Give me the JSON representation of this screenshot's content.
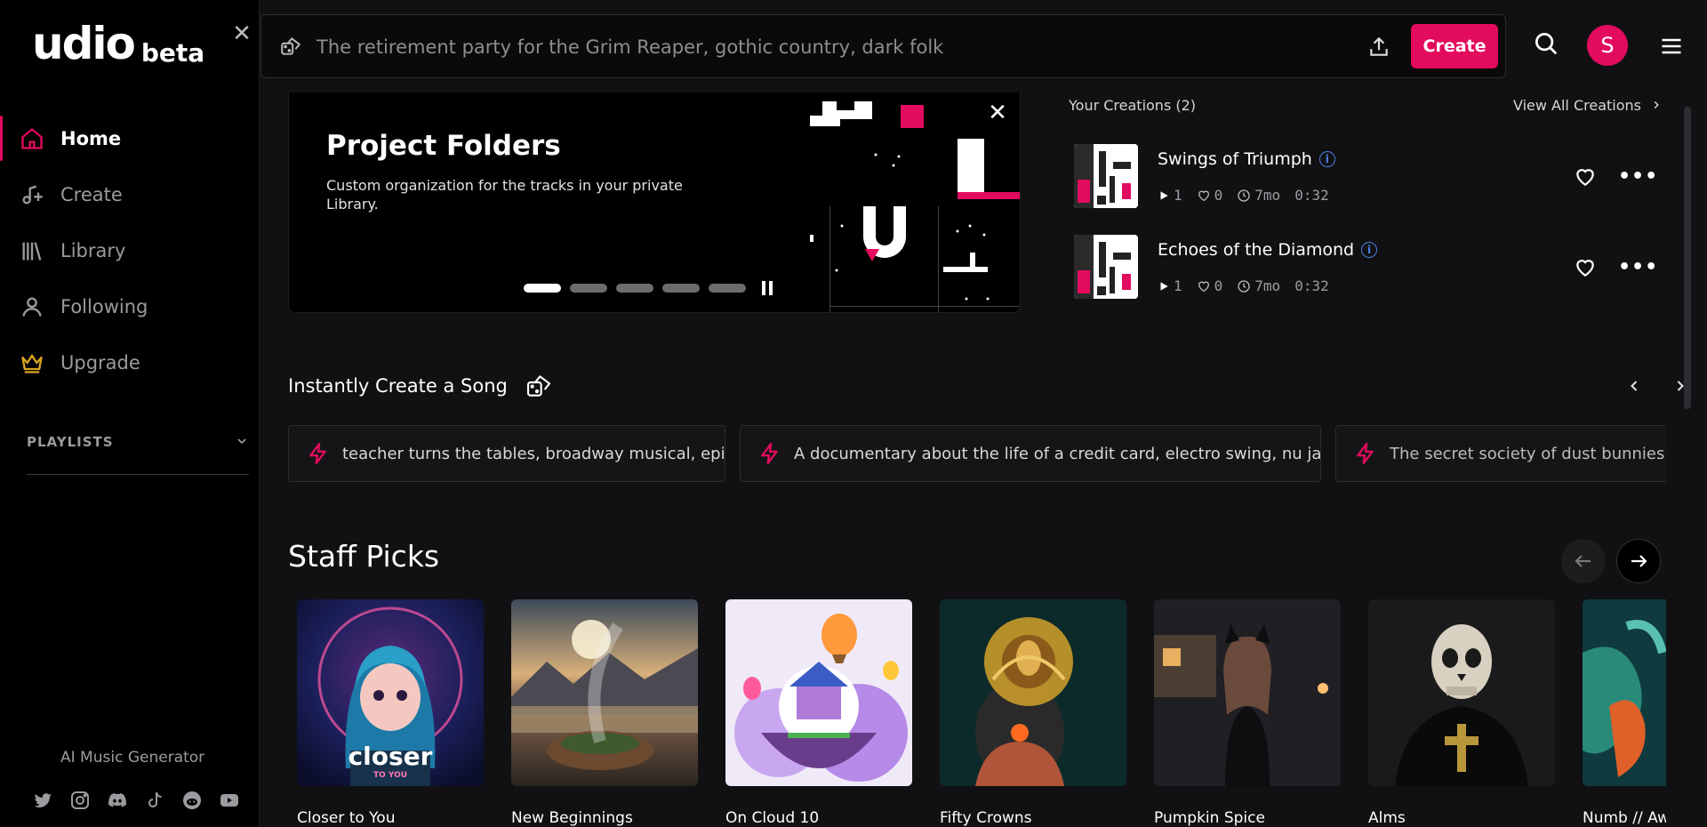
{
  "brand": {
    "name": "udio",
    "tag": "beta"
  },
  "nav": {
    "items": [
      {
        "label": "Home",
        "icon": "home-icon"
      },
      {
        "label": "Create",
        "icon": "music-plus-icon"
      },
      {
        "label": "Library",
        "icon": "library-icon"
      },
      {
        "label": "Following",
        "icon": "person-icon"
      },
      {
        "label": "Upgrade",
        "icon": "crown-icon"
      }
    ],
    "active": "Home",
    "accent": "#e30b5d"
  },
  "playlists": {
    "label": "PLAYLISTS"
  },
  "footer": {
    "label": "AI Music Generator",
    "socials": [
      "twitter-icon",
      "instagram-icon",
      "discord-icon",
      "tiktok-icon",
      "reddit-icon",
      "youtube-icon"
    ]
  },
  "topbar": {
    "search_placeholder": "The retirement party for the Grim Reaper, gothic country, dark folk",
    "create_label": "Create",
    "avatar_letter": "S"
  },
  "banner": {
    "title": "Project Folders",
    "description": "Custom organization for the tracks in your private Library.",
    "slides": 5,
    "active_slide": 1
  },
  "creations": {
    "heading": "Your Creations (2)",
    "view_all": "View All Creations",
    "items": [
      {
        "title": "Swings of Triumph",
        "plays": "1",
        "likes": "0",
        "age": "7mo",
        "duration": "0:32"
      },
      {
        "title": "Echoes of the Diamond",
        "plays": "1",
        "likes": "0",
        "age": "7mo",
        "duration": "0:32"
      }
    ]
  },
  "instant": {
    "title": "Instantly Create a Song",
    "prompts": [
      "teacher turns the tables, broadway musical, epic",
      "A documentary about the life of a credit card, electro swing, nu jazz",
      "The secret society of dust bunnies u"
    ]
  },
  "staff_picks": {
    "title": "Staff Picks",
    "cards": [
      {
        "name": "Closer to You",
        "art_text": "closer",
        "art_sub": "TO YOU"
      },
      {
        "name": "New Beginnings"
      },
      {
        "name": "On Cloud 10"
      },
      {
        "name": "Fifty Crowns"
      },
      {
        "name": "Pumpkin Spice"
      },
      {
        "name": "Alms"
      },
      {
        "name": "Numb // Aw"
      }
    ]
  }
}
